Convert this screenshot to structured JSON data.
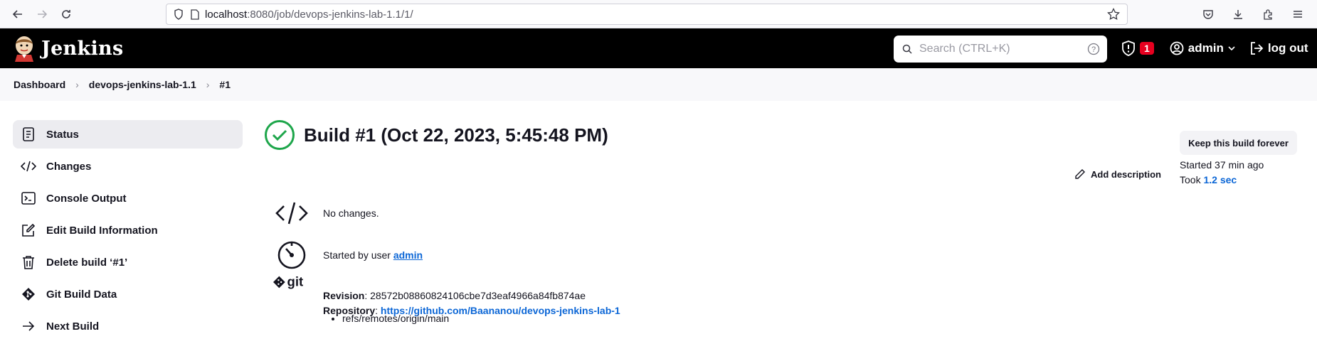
{
  "browser": {
    "url_host": "localhost",
    "url_path": ":8080/job/devops-jenkins-lab-1.1/1/"
  },
  "header": {
    "brand": "Jenkins",
    "search_placeholder": "Search (CTRL+K)",
    "alert_count": "1",
    "user": "admin",
    "logout": "log out"
  },
  "breadcrumb": [
    "Dashboard",
    "devops-jenkins-lab-1.1",
    "#1"
  ],
  "sidebar": {
    "items": [
      {
        "label": "Status",
        "icon": "status-icon"
      },
      {
        "label": "Changes",
        "icon": "code-icon"
      },
      {
        "label": "Console Output",
        "icon": "terminal-icon"
      },
      {
        "label": "Edit Build Information",
        "icon": "edit-icon"
      },
      {
        "label": "Delete build ‘#1’",
        "icon": "trash-icon"
      },
      {
        "label": "Git Build Data",
        "icon": "git-icon"
      },
      {
        "label": "Next Build",
        "icon": "arrow-right-icon"
      }
    ]
  },
  "build": {
    "title": "Build #1 (Oct 22, 2023, 5:45:48 PM)",
    "keep_button": "Keep this build forever",
    "add_description": "Add description",
    "started": "Started 37 min ago",
    "took_prefix": "Took",
    "took_value": "1.2 sec",
    "changes": "No changes.",
    "started_by_prefix": "Started by user",
    "started_by_user": "admin",
    "revision_label": "Revision",
    "revision": "28572b08860824106cbe7d3eaf4966a84fb874ae",
    "repository_label": "Repository",
    "repository": "https://github.com/Baananou/devops-jenkins-lab-1",
    "git_label": "git",
    "ref": "refs/remotes/origin/main"
  },
  "colors": {
    "success": "#1ea64b",
    "link": "#0b66d6",
    "alert": "#e6001f"
  }
}
